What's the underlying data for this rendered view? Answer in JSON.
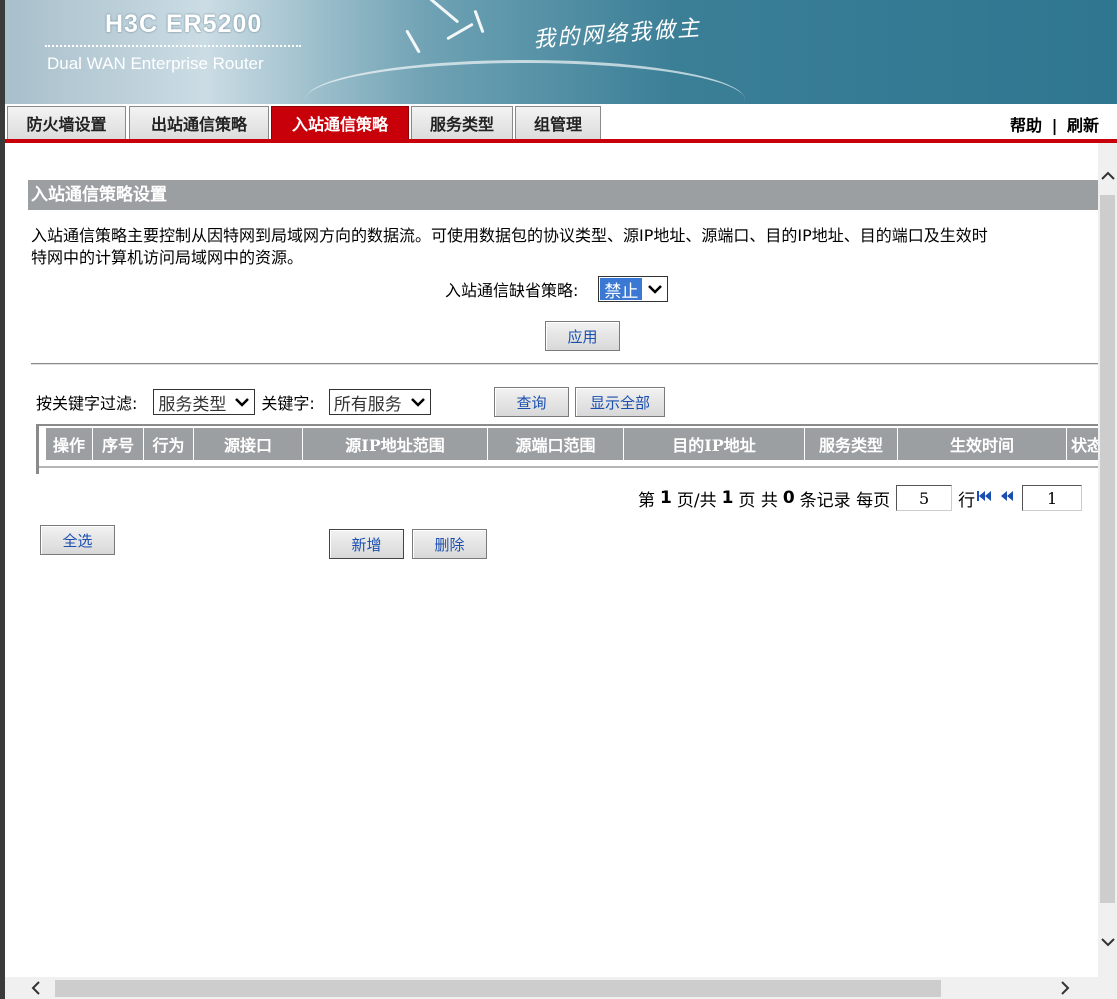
{
  "banner": {
    "brand": "H3C ER5200",
    "subtitle": "Dual WAN Enterprise Router",
    "slogan": "我的网络我做主"
  },
  "tabs": [
    {
      "label": "防火墙设置",
      "active": false
    },
    {
      "label": "出站通信策略",
      "active": false
    },
    {
      "label": "入站通信策略",
      "active": true
    },
    {
      "label": "服务类型",
      "active": false
    },
    {
      "label": "组管理",
      "active": false
    }
  ],
  "header_links": {
    "help": "帮助",
    "separator": "|",
    "refresh": "刷新"
  },
  "section": {
    "title": "入站通信策略设置",
    "description": "入站通信策略主要控制从因特网到局域网方向的数据流。可使用数据包的协议类型、源IP地址、源端口、目的IP地址、目的端口及生效时间等参数控制因特网中的计算机访问局域网中的资源。",
    "description_line1": "入站通信策略主要控制从因特网到局域网方向的数据流。可使用数据包的协议类型、源IP地址、源端口、目的IP地址、目的端口及生效时",
    "description_line2": "特网中的计算机访问局域网中的资源。"
  },
  "default_policy": {
    "label": "入站通信缺省策略:",
    "value": "禁止"
  },
  "apply_button": "应用",
  "filter": {
    "label": "按关键字过滤:",
    "field_value": "服务类型",
    "keyword_label": "关键字:",
    "keyword_value": "所有服务",
    "query_button": "查询",
    "show_all_button": "显示全部"
  },
  "table": {
    "columns": [
      "操作",
      "序号",
      "行为",
      "源接口",
      "源IP地址范围",
      "源端口范围",
      "目的IP地址",
      "服务类型",
      "生效时间",
      "状态"
    ],
    "rows": []
  },
  "pager": {
    "prefix": "第",
    "current_page": "1",
    "page_sep": "页/共",
    "total_pages": "1",
    "pages_suffix": "页 共",
    "record_count": "0",
    "records_suffix": "条记录 每页",
    "per_page": "5",
    "rows_label": "行",
    "page_input": "1"
  },
  "buttons": {
    "select_all": "全选",
    "add": "新增",
    "delete": "删除"
  }
}
